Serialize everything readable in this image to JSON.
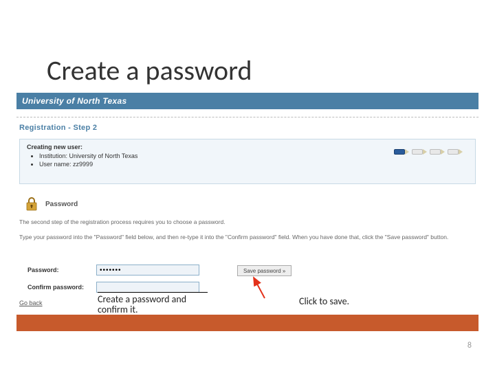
{
  "slide": {
    "title": "Create a password",
    "page_number": "8"
  },
  "header": {
    "university": "University of North Texas",
    "step_title": "Registration - Step 2"
  },
  "panel": {
    "creating_label": "Creating new user:",
    "institution_label": "Institution:",
    "institution_value": "University of North Texas",
    "username_label": "User name:",
    "username_value": "zz9999"
  },
  "password_section": {
    "heading": "Password",
    "instruction1": "The second step of the registration process requires you to choose a password.",
    "instruction2": "Type your password into the \"Password\" field below, and then re-type it into the \"Confirm password\" field. When you have done that, click the \"Save password\" button."
  },
  "form": {
    "password_label": "Password:",
    "password_value": "•••••••",
    "confirm_label": "Confirm password:",
    "confirm_value": "",
    "save_button": "Save password »"
  },
  "nav": {
    "go_back": "Go back"
  },
  "callouts": {
    "create_confirm": "Create a password and confirm it.",
    "click_save": "Click to save."
  },
  "colors": {
    "header_bar": "#4a7fa5",
    "accent_bar": "#c75a2c",
    "arrow": "#e3311a"
  }
}
